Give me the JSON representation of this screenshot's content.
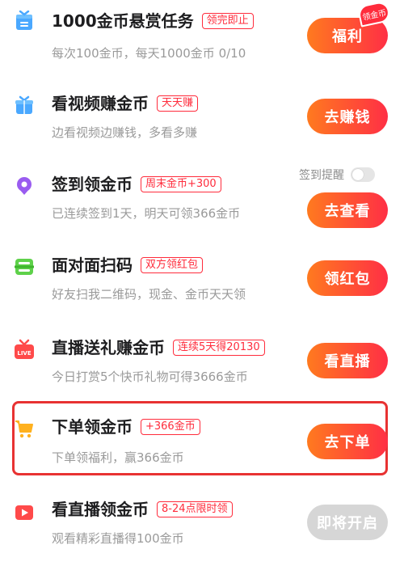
{
  "tasks": [
    {
      "icon": "gift-box-icon",
      "title": "1000金币悬赏任务",
      "tag": "领完即止",
      "desc": "每次100金币，每天1000金币 0/10",
      "button": "福利",
      "badge": "领金币"
    },
    {
      "icon": "gift-box-icon",
      "title": "看视频赚金币",
      "tag": "天天赚",
      "desc": "边看视频边赚钱，多看多赚",
      "button": "去赚钱"
    },
    {
      "icon": "location-pin-icon",
      "title": "签到领金币",
      "tag": "周末金币+300",
      "desc": "已连续签到1天，明天可领366金币",
      "button": "去查看",
      "reminder_label": "签到提醒",
      "reminder_on": false
    },
    {
      "icon": "scan-icon",
      "title": "面对面扫码",
      "tag": "双方领红包",
      "desc": "好友扫我二维码，现金、金币天天领",
      "button": "领红包"
    },
    {
      "icon": "live-gift-icon",
      "title": "直播送礼赚金币",
      "tag": "连续5天得20130",
      "desc": "今日打赏5个快币礼物可得3666金币",
      "button": "看直播"
    },
    {
      "icon": "shopping-cart-icon",
      "title": "下单领金币",
      "tag": "+366金币",
      "desc": "下单领福利，赢366金币",
      "button": "去下单",
      "highlighted": true
    },
    {
      "icon": "video-play-icon",
      "title": "看直播领金币",
      "tag": "8-24点限时领",
      "desc": "观看精彩直播得100金币",
      "button": "即将开启",
      "disabled": true
    }
  ],
  "colors": {
    "accent": "#ff2c3c",
    "button_start": "#ff7a1f",
    "button_end": "#ff2f45",
    "disabled": "#d6d6d6",
    "highlight_border": "#e83232"
  }
}
